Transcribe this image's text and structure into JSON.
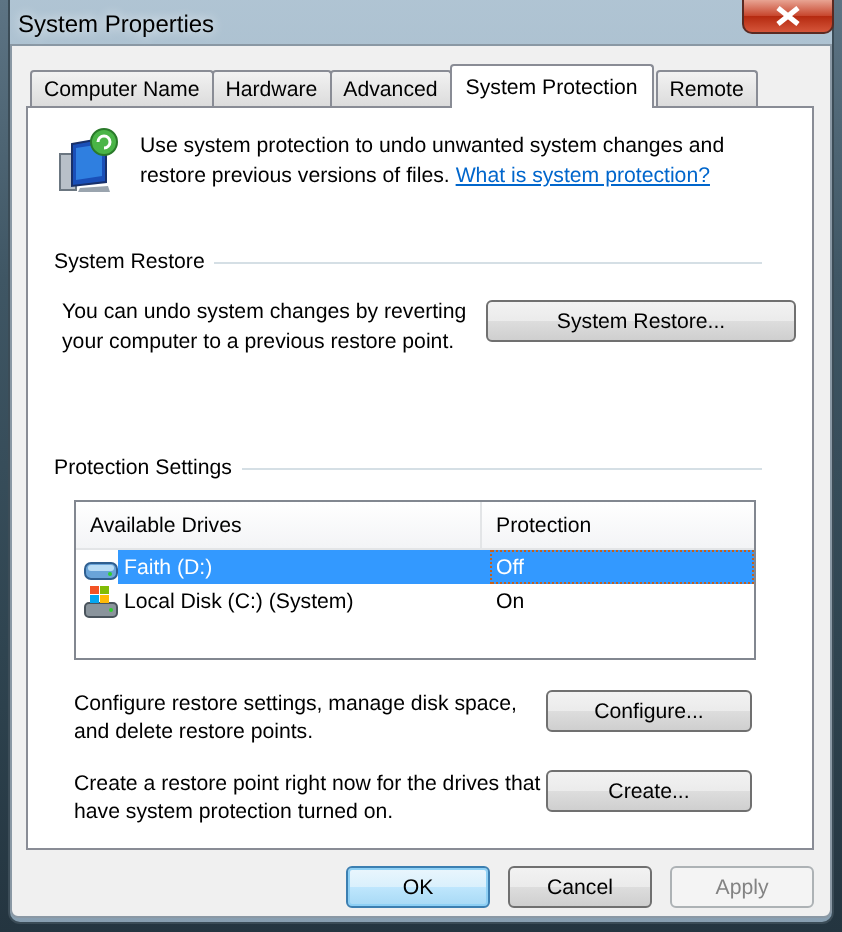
{
  "window": {
    "title": "System Properties"
  },
  "tabs": [
    {
      "label": "Computer Name",
      "selected": false
    },
    {
      "label": "Hardware",
      "selected": false
    },
    {
      "label": "Advanced",
      "selected": false
    },
    {
      "label": "System Protection",
      "selected": true
    },
    {
      "label": "Remote",
      "selected": false
    }
  ],
  "intro": {
    "text": "Use system protection to undo unwanted system changes and restore previous versions of files.",
    "link": "What is system protection?"
  },
  "system_restore": {
    "title": "System Restore",
    "description": "You can undo system changes by reverting your computer to a previous restore point.",
    "button": "System Restore..."
  },
  "protection_settings": {
    "title": "Protection Settings",
    "columns": [
      "Available Drives",
      "Protection"
    ],
    "rows": [
      {
        "drive": "Faith (D:)",
        "protection": "Off",
        "kind": "drive",
        "selected": true
      },
      {
        "drive": "Local Disk (C:) (System)",
        "protection": "On",
        "kind": "system",
        "selected": false
      }
    ],
    "actions": [
      {
        "description": "Configure restore settings, manage disk space, and delete restore points.",
        "button": "Configure..."
      },
      {
        "description": "Create a restore point right now for the drives that have system protection turned on.",
        "button": "Create..."
      }
    ]
  },
  "buttons": [
    {
      "label": "OK",
      "default": true,
      "disabled": false
    },
    {
      "label": "Cancel",
      "default": false,
      "disabled": false
    },
    {
      "label": "Apply",
      "default": false,
      "disabled": true
    }
  ]
}
